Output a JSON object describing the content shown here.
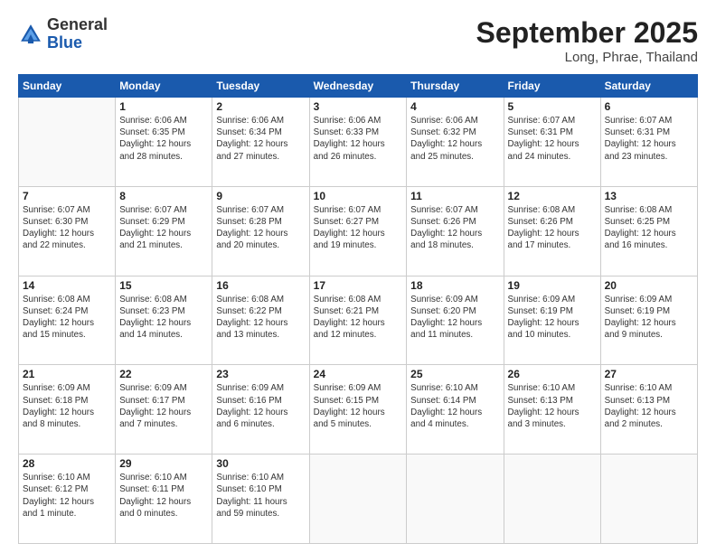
{
  "header": {
    "logo": {
      "general": "General",
      "blue": "Blue"
    },
    "month": "September 2025",
    "location": "Long, Phrae, Thailand"
  },
  "calendar": {
    "days_of_week": [
      "Sunday",
      "Monday",
      "Tuesday",
      "Wednesday",
      "Thursday",
      "Friday",
      "Saturday"
    ],
    "weeks": [
      [
        {
          "day": "",
          "info": ""
        },
        {
          "day": "1",
          "info": "Sunrise: 6:06 AM\nSunset: 6:35 PM\nDaylight: 12 hours\nand 28 minutes."
        },
        {
          "day": "2",
          "info": "Sunrise: 6:06 AM\nSunset: 6:34 PM\nDaylight: 12 hours\nand 27 minutes."
        },
        {
          "day": "3",
          "info": "Sunrise: 6:06 AM\nSunset: 6:33 PM\nDaylight: 12 hours\nand 26 minutes."
        },
        {
          "day": "4",
          "info": "Sunrise: 6:06 AM\nSunset: 6:32 PM\nDaylight: 12 hours\nand 25 minutes."
        },
        {
          "day": "5",
          "info": "Sunrise: 6:07 AM\nSunset: 6:31 PM\nDaylight: 12 hours\nand 24 minutes."
        },
        {
          "day": "6",
          "info": "Sunrise: 6:07 AM\nSunset: 6:31 PM\nDaylight: 12 hours\nand 23 minutes."
        }
      ],
      [
        {
          "day": "7",
          "info": "Sunrise: 6:07 AM\nSunset: 6:30 PM\nDaylight: 12 hours\nand 22 minutes."
        },
        {
          "day": "8",
          "info": "Sunrise: 6:07 AM\nSunset: 6:29 PM\nDaylight: 12 hours\nand 21 minutes."
        },
        {
          "day": "9",
          "info": "Sunrise: 6:07 AM\nSunset: 6:28 PM\nDaylight: 12 hours\nand 20 minutes."
        },
        {
          "day": "10",
          "info": "Sunrise: 6:07 AM\nSunset: 6:27 PM\nDaylight: 12 hours\nand 19 minutes."
        },
        {
          "day": "11",
          "info": "Sunrise: 6:07 AM\nSunset: 6:26 PM\nDaylight: 12 hours\nand 18 minutes."
        },
        {
          "day": "12",
          "info": "Sunrise: 6:08 AM\nSunset: 6:26 PM\nDaylight: 12 hours\nand 17 minutes."
        },
        {
          "day": "13",
          "info": "Sunrise: 6:08 AM\nSunset: 6:25 PM\nDaylight: 12 hours\nand 16 minutes."
        }
      ],
      [
        {
          "day": "14",
          "info": "Sunrise: 6:08 AM\nSunset: 6:24 PM\nDaylight: 12 hours\nand 15 minutes."
        },
        {
          "day": "15",
          "info": "Sunrise: 6:08 AM\nSunset: 6:23 PM\nDaylight: 12 hours\nand 14 minutes."
        },
        {
          "day": "16",
          "info": "Sunrise: 6:08 AM\nSunset: 6:22 PM\nDaylight: 12 hours\nand 13 minutes."
        },
        {
          "day": "17",
          "info": "Sunrise: 6:08 AM\nSunset: 6:21 PM\nDaylight: 12 hours\nand 12 minutes."
        },
        {
          "day": "18",
          "info": "Sunrise: 6:09 AM\nSunset: 6:20 PM\nDaylight: 12 hours\nand 11 minutes."
        },
        {
          "day": "19",
          "info": "Sunrise: 6:09 AM\nSunset: 6:19 PM\nDaylight: 12 hours\nand 10 minutes."
        },
        {
          "day": "20",
          "info": "Sunrise: 6:09 AM\nSunset: 6:19 PM\nDaylight: 12 hours\nand 9 minutes."
        }
      ],
      [
        {
          "day": "21",
          "info": "Sunrise: 6:09 AM\nSunset: 6:18 PM\nDaylight: 12 hours\nand 8 minutes."
        },
        {
          "day": "22",
          "info": "Sunrise: 6:09 AM\nSunset: 6:17 PM\nDaylight: 12 hours\nand 7 minutes."
        },
        {
          "day": "23",
          "info": "Sunrise: 6:09 AM\nSunset: 6:16 PM\nDaylight: 12 hours\nand 6 minutes."
        },
        {
          "day": "24",
          "info": "Sunrise: 6:09 AM\nSunset: 6:15 PM\nDaylight: 12 hours\nand 5 minutes."
        },
        {
          "day": "25",
          "info": "Sunrise: 6:10 AM\nSunset: 6:14 PM\nDaylight: 12 hours\nand 4 minutes."
        },
        {
          "day": "26",
          "info": "Sunrise: 6:10 AM\nSunset: 6:13 PM\nDaylight: 12 hours\nand 3 minutes."
        },
        {
          "day": "27",
          "info": "Sunrise: 6:10 AM\nSunset: 6:13 PM\nDaylight: 12 hours\nand 2 minutes."
        }
      ],
      [
        {
          "day": "28",
          "info": "Sunrise: 6:10 AM\nSunset: 6:12 PM\nDaylight: 12 hours\nand 1 minute."
        },
        {
          "day": "29",
          "info": "Sunrise: 6:10 AM\nSunset: 6:11 PM\nDaylight: 12 hours\nand 0 minutes."
        },
        {
          "day": "30",
          "info": "Sunrise: 6:10 AM\nSunset: 6:10 PM\nDaylight: 11 hours\nand 59 minutes."
        },
        {
          "day": "",
          "info": ""
        },
        {
          "day": "",
          "info": ""
        },
        {
          "day": "",
          "info": ""
        },
        {
          "day": "",
          "info": ""
        }
      ]
    ]
  }
}
